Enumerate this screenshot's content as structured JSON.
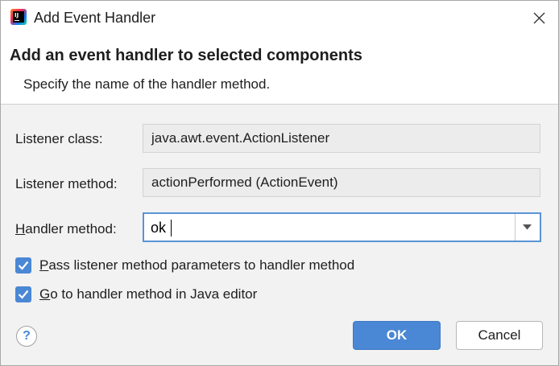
{
  "window": {
    "title": "Add Event Handler",
    "app_icon_text": "IJ",
    "app_icon": "intellij-idea-icon",
    "close_icon": "close-icon"
  },
  "header": {
    "title": "Add an event handler to selected components",
    "subtitle": "Specify the name of the handler method."
  },
  "form": {
    "listener_class": {
      "label": "Listener class:",
      "value": "java.awt.event.ActionListener"
    },
    "listener_method": {
      "label": "Listener method:",
      "value": "actionPerformed (ActionEvent)"
    },
    "handler_method": {
      "label_mnemonic": "H",
      "label_rest": "andler method:",
      "value": "ok",
      "dropdown_icon": "chevron-down-icon"
    }
  },
  "options": [
    {
      "mnemonic": "P",
      "label_rest": "ass listener method parameters to handler method",
      "checked": true
    },
    {
      "mnemonic": "G",
      "label_rest": "o to handler method in Java editor",
      "checked": true
    }
  ],
  "footer": {
    "help_label": "?",
    "ok_label": "OK",
    "cancel_label": "Cancel"
  },
  "colors": {
    "accent": "#4a87d5",
    "focus_border": "#5a93d6",
    "dialog_bg": "#f2f2f2",
    "header_bg": "#ffffff"
  }
}
